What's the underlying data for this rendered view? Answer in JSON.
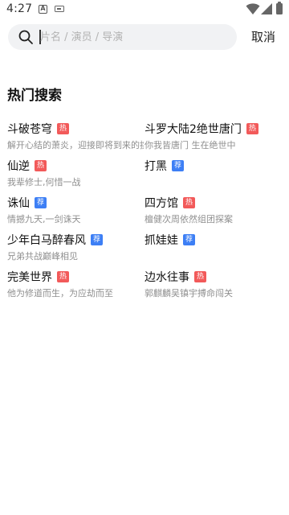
{
  "status_bar": {
    "time": "4:27",
    "app_icon_letter": "A"
  },
  "search": {
    "placeholder": "片名 / 演员 / 导演",
    "value": "",
    "cancel_label": "取消"
  },
  "hot_search": {
    "title": "热门搜索",
    "items": [
      {
        "name": "斗破苍穹",
        "badge": "热",
        "badge_type": "hot",
        "desc": "解开心结的萧炎，迎接即将到来的挑战"
      },
      {
        "name": "斗罗大陆2绝世唐门",
        "badge": "热",
        "badge_type": "hot",
        "desc": "你我皆唐门 生在绝世中"
      },
      {
        "name": "仙逆",
        "badge": "热",
        "badge_type": "hot",
        "desc": "我辈修士,何惜一战"
      },
      {
        "name": "打黑",
        "badge": "荐",
        "badge_type": "rec",
        "desc": ""
      },
      {
        "name": "诛仙",
        "badge": "荐",
        "badge_type": "rec",
        "desc": "情撼九天,一剑诛天"
      },
      {
        "name": "四方馆",
        "badge": "热",
        "badge_type": "hot",
        "desc": "檀健次周依然组团探案"
      },
      {
        "name": "少年白马醉春风",
        "badge": "荐",
        "badge_type": "rec",
        "desc": "兄弟共战巅峰相见"
      },
      {
        "name": "抓娃娃",
        "badge": "荐",
        "badge_type": "rec",
        "desc": ""
      },
      {
        "name": "完美世界",
        "badge": "热",
        "badge_type": "hot",
        "desc": "他为修道而生，为应劫而至"
      },
      {
        "name": "边水往事",
        "badge": "热",
        "badge_type": "hot",
        "desc": "郭麒麟吴镇宇搏命闯关"
      }
    ]
  },
  "colors": {
    "hot_badge": "#f25a5a",
    "rec_badge": "#3d7ff5",
    "search_bg": "#f1f2f4"
  }
}
